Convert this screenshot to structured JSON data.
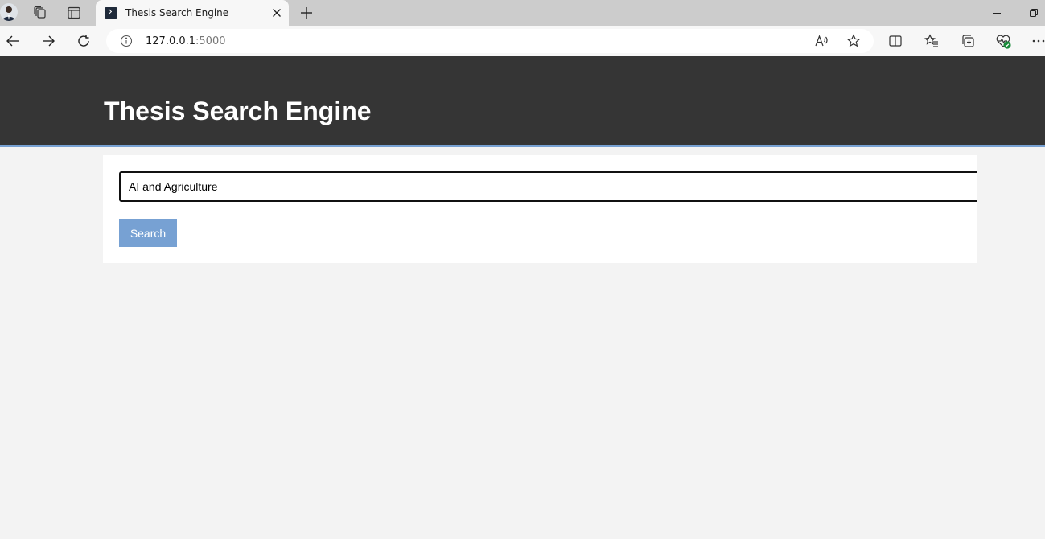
{
  "browser": {
    "tab": {
      "title": "Thesis Search Engine"
    },
    "address": {
      "host": "127.0.0.1",
      "port": ":5000"
    }
  },
  "page": {
    "header": {
      "title": "Thesis Search Engine"
    },
    "search": {
      "query": "AI and Agriculture",
      "button_label": "Search"
    }
  },
  "colors": {
    "header_bg": "#353535",
    "header_border": "#77a1d3",
    "button_bg": "#77a1d3",
    "page_bg": "#f3f3f3"
  },
  "icons": [
    "profile-avatar",
    "workspaces-icon",
    "tab-actions-icon",
    "terminal-favicon",
    "close-icon",
    "new-tab-icon",
    "minimize-icon",
    "restore-icon",
    "back-icon",
    "forward-icon",
    "refresh-icon",
    "info-icon",
    "read-aloud-icon",
    "favorite-star-icon",
    "split-screen-icon",
    "favorites-icon",
    "collections-icon",
    "browser-essentials-icon",
    "more-icon"
  ]
}
